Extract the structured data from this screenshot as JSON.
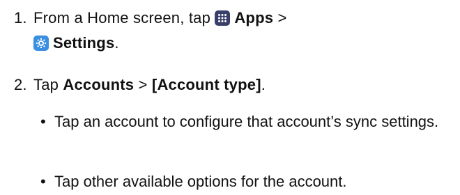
{
  "steps": [
    {
      "number": "1.",
      "pre": "From a Home screen, tap",
      "apps_label": "Apps",
      "separator": ">",
      "settings_label": "Settings",
      "end": ".",
      "icons": [
        "apps-grid-icon",
        "settings-gear-icon"
      ]
    },
    {
      "number": "2.",
      "pre": "Tap",
      "accounts_label": "Accounts",
      "separator": ">",
      "account_type_label": "[Account type]",
      "end": "."
    }
  ],
  "bullets": [
    "Tap an account to configure that account’s sync settings.",
    "Tap other available options for the account."
  ],
  "bullet_symbol": "•",
  "colors": {
    "apps_icon_bg": "#3a3f6a",
    "settings_icon_bg": "#3b8fe0",
    "text": "#111111"
  }
}
